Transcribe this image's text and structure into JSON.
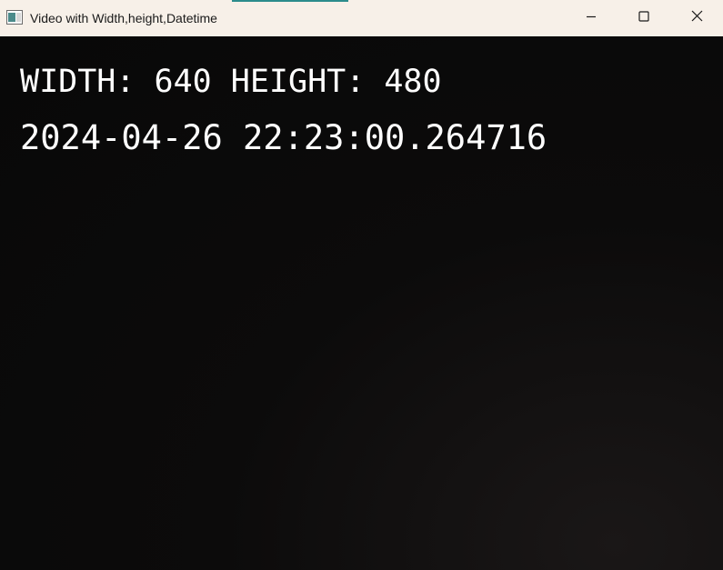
{
  "window": {
    "title": "Video with Width,height,Datetime",
    "icon": "app-window-icon",
    "controls": {
      "minimize_icon": "minimize-icon",
      "maximize_icon": "maximize-icon",
      "close_icon": "close-icon"
    },
    "colors": {
      "titlebar_bg": "#f7f0e8",
      "accent_strip": "#2c8c8c",
      "video_bg": "#0a0a0a",
      "overlay_text": "#ffffff"
    }
  },
  "video": {
    "dimensions_text": "WIDTH: 640 HEIGHT: 480",
    "datetime_text": "2024-04-26 22:23:00.264716"
  }
}
